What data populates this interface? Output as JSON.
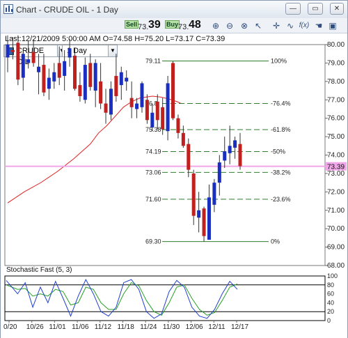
{
  "window": {
    "title": "Chart - CRUDE OIL - 1 Day",
    "minimize_glyph": "—",
    "maximize_glyph": "▭",
    "close_glyph": "✕"
  },
  "toolbar": {
    "symbol": "CRUDE OIL",
    "period": "1 Day",
    "sell_label": "Sell",
    "sell_price_small": "73.",
    "sell_price_big": "39",
    "buy_label": "Buy",
    "buy_price_small": "73.",
    "buy_price_big": "48",
    "tools": [
      "zoom-in-icon",
      "zoom-out-icon",
      "zoom-reset-icon",
      "cursor-icon",
      "crosshair-icon",
      "indicator-icon",
      "hand-icon",
      "save-icon"
    ],
    "fx_label": "f(x)"
  },
  "info": {
    "last_line": "Last:12/21/2009 5:00:00 AM O=74.58 H=75.20 L=73.17 C=73.39"
  },
  "price_axis": {
    "min": 68.0,
    "max": 80.0,
    "ticks": [
      "80.00",
      "79.00",
      "78.00",
      "77.00",
      "76.00",
      "75.00",
      "74.00",
      "73.00",
      "72.00",
      "71.00",
      "70.00",
      "69.00",
      "68.00"
    ],
    "current_price": "73.39"
  },
  "fib_levels": [
    {
      "price": "79.11",
      "pct": "100%",
      "style": "solid"
    },
    {
      "price": "76.8",
      "pct": "-76.4%",
      "style": "dashed"
    },
    {
      "price": "75.38",
      "pct": "-61.8%",
      "style": "dashed"
    },
    {
      "price": "74.19",
      "pct": "-50%",
      "style": "dashed"
    },
    {
      "price": "73.06",
      "pct": "-38.2%",
      "style": "dashed"
    },
    {
      "price": "71.60",
      "pct": "-23.6%",
      "style": "dashed"
    },
    {
      "price": "69.30",
      "pct": "0%",
      "style": "solid"
    }
  ],
  "stochastic": {
    "title": "Stochastic Fast (5, 3)",
    "ticks": [
      "100",
      "80",
      "60",
      "40",
      "20",
      "0"
    ]
  },
  "date_axis": {
    "labels": [
      "0/20",
      "10/26",
      "11/01",
      "11/06",
      "11/12",
      "11/18",
      "11/24",
      "11/30",
      "12/06",
      "12/11",
      "12/17"
    ]
  },
  "colors": {
    "up_candle": "#1a2fbf",
    "down_candle": "#c0201e",
    "moving_average": "#e02020",
    "fib_line": "#2e7d2e",
    "current_price_line": "#f0a6e8",
    "stoch_fast": "#1f3fd0",
    "stoch_slow": "#26a226"
  },
  "candles": [
    [
      79.3,
      80.5,
      78.5,
      80.0
    ],
    [
      79.7,
      80.4,
      79.2,
      79.6
    ],
    [
      80.1,
      80.5,
      77.8,
      78.1
    ],
    [
      78.2,
      79.8,
      77.5,
      79.5
    ],
    [
      79.0,
      80.2,
      78.7,
      79.2
    ],
    [
      79.6,
      80.3,
      78.8,
      79.0
    ],
    [
      78.5,
      79.5,
      77.3,
      78.8
    ],
    [
      78.9,
      79.5,
      77.2,
      77.4
    ],
    [
      77.6,
      78.7,
      77.0,
      78.2
    ],
    [
      78.0,
      79.0,
      77.6,
      78.5
    ],
    [
      79.0,
      79.9,
      77.8,
      78.2
    ],
    [
      78.3,
      79.7,
      77.5,
      79.1
    ],
    [
      79.3,
      80.3,
      78.8,
      79.8
    ],
    [
      79.4,
      79.8,
      77.5,
      77.6
    ],
    [
      77.8,
      78.5,
      76.9,
      77.2
    ],
    [
      77.0,
      79.3,
      76.8,
      78.9
    ],
    [
      79.0,
      79.5,
      77.5,
      77.7
    ],
    [
      77.5,
      79.2,
      76.6,
      79.0
    ],
    [
      78.0,
      79.0,
      76.5,
      76.8
    ],
    [
      76.8,
      77.6,
      75.7,
      76.3
    ],
    [
      76.2,
      78.0,
      75.9,
      77.6
    ],
    [
      78.3,
      79.5,
      76.9,
      77.2
    ],
    [
      77.8,
      78.8,
      77.0,
      78.5
    ],
    [
      78.0,
      78.6,
      77.5,
      78.2
    ],
    [
      77.1,
      78.0,
      76.0,
      76.6
    ],
    [
      76.5,
      77.1,
      76.0,
      76.8
    ],
    [
      76.6,
      78.0,
      76.3,
      77.9
    ],
    [
      77.0,
      77.3,
      75.7,
      75.9
    ],
    [
      75.5,
      76.8,
      75.3,
      76.3
    ],
    [
      76.9,
      77.3,
      75.4,
      75.9
    ],
    [
      76.6,
      77.1,
      75.1,
      75.4
    ],
    [
      75.3,
      78.3,
      74.8,
      77.9
    ],
    [
      79.0,
      79.1,
      75.9,
      76.0
    ],
    [
      76.0,
      76.2,
      74.9,
      75.2
    ],
    [
      75.2,
      75.6,
      74.4,
      74.5
    ],
    [
      74.6,
      74.9,
      72.8,
      73.2
    ],
    [
      73.0,
      73.2,
      70.2,
      70.7
    ],
    [
      70.6,
      72.0,
      69.8,
      71.0
    ],
    [
      71.1,
      71.2,
      69.3,
      69.6
    ],
    [
      69.4,
      72.4,
      69.4,
      71.7
    ],
    [
      71.3,
      72.7,
      70.9,
      72.5
    ],
    [
      72.5,
      74.0,
      71.8,
      73.6
    ],
    [
      73.7,
      75.0,
      73.3,
      74.2
    ],
    [
      74.1,
      75.6,
      73.5,
      74.5
    ],
    [
      74.4,
      75.0,
      73.8,
      74.8
    ],
    [
      74.6,
      75.2,
      73.2,
      73.4
    ]
  ],
  "ma_points": [
    [
      0,
      71.4
    ],
    [
      8,
      72.0
    ],
    [
      16,
      72.5
    ],
    [
      24,
      73.1
    ],
    [
      32,
      73.8
    ],
    [
      40,
      74.6
    ],
    [
      44,
      75.2
    ],
    [
      48,
      75.6
    ],
    [
      52,
      76.1
    ],
    [
      56,
      76.6
    ],
    [
      60,
      76.9
    ],
    [
      64,
      77.1
    ],
    [
      70,
      77.2
    ],
    [
      74,
      77.15
    ],
    [
      78,
      77.05
    ],
    [
      82,
      76.9
    ],
    [
      84,
      76.8
    ]
  ],
  "stoch_fast_points": [
    [
      0,
      90
    ],
    [
      3,
      60
    ],
    [
      5,
      85
    ],
    [
      7,
      30
    ],
    [
      9,
      75
    ],
    [
      11,
      40
    ],
    [
      13,
      88
    ],
    [
      15,
      50
    ],
    [
      17,
      10
    ],
    [
      19,
      55
    ],
    [
      21,
      92
    ],
    [
      23,
      60
    ],
    [
      25,
      20
    ],
    [
      27,
      10
    ],
    [
      29,
      30
    ],
    [
      31,
      85
    ],
    [
      33,
      92
    ],
    [
      35,
      70
    ],
    [
      37,
      20
    ],
    [
      39,
      5
    ],
    [
      41,
      15
    ],
    [
      43,
      65
    ],
    [
      45,
      90
    ],
    [
      47,
      75
    ],
    [
      49,
      30
    ],
    [
      51,
      10
    ],
    [
      53,
      5
    ],
    [
      55,
      25
    ],
    [
      57,
      60
    ],
    [
      59,
      88
    ],
    [
      61,
      70
    ]
  ],
  "stoch_slow_points": [
    [
      0,
      80
    ],
    [
      3,
      70
    ],
    [
      5,
      72
    ],
    [
      7,
      55
    ],
    [
      9,
      60
    ],
    [
      11,
      55
    ],
    [
      13,
      70
    ],
    [
      15,
      65
    ],
    [
      17,
      35
    ],
    [
      19,
      40
    ],
    [
      21,
      75
    ],
    [
      23,
      70
    ],
    [
      25,
      40
    ],
    [
      27,
      25
    ],
    [
      29,
      25
    ],
    [
      31,
      60
    ],
    [
      33,
      85
    ],
    [
      35,
      78
    ],
    [
      37,
      45
    ],
    [
      39,
      20
    ],
    [
      41,
      12
    ],
    [
      43,
      40
    ],
    [
      45,
      75
    ],
    [
      47,
      80
    ],
    [
      49,
      50
    ],
    [
      51,
      25
    ],
    [
      53,
      12
    ],
    [
      55,
      18
    ],
    [
      57,
      45
    ],
    [
      59,
      75
    ],
    [
      61,
      82
    ]
  ]
}
